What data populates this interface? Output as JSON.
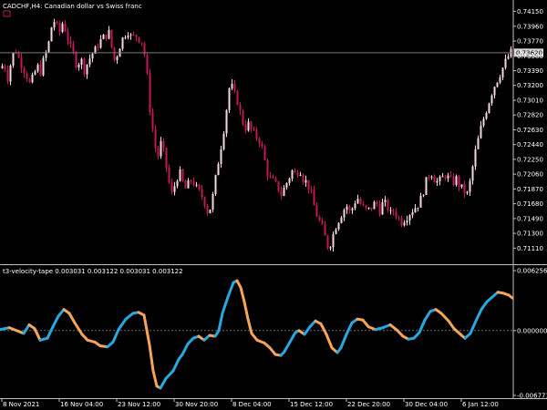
{
  "header": {
    "symbol_line": "CADCHF,H4:  Canadian dollar vs Swiss franc",
    "indicator_line": "t3-velocity-tape 0.003031 0.003122 0.003031 0.003122"
  },
  "colors": {
    "background": "#000000",
    "axis": "#c0c0c0",
    "bull_candle": "#f5d7e0",
    "bear_candle": "#c2185b",
    "price_line": "#7a7a7a",
    "osc_up": "#29a8e0",
    "osc_down": "#f5a55a",
    "zero_line": "#6a6a6a"
  },
  "chart_data": [
    {
      "type": "candlestick",
      "title": "CADCHF,H4:  Canadian dollar vs Swiss franc",
      "ylim": [
        0.7095,
        0.7425
      ],
      "y_ticks": [
        "0.74150",
        "0.73960",
        "0.73770",
        "0.73580",
        "0.73390",
        "0.73200",
        "0.73010",
        "0.72820",
        "0.72630",
        "0.72440",
        "0.72250",
        "0.72060",
        "0.71870",
        "0.71680",
        "0.71490",
        "0.71300",
        "0.71110"
      ],
      "current_price": "0.73620",
      "x_ticks": [
        "8 Nov 2021",
        "16 Nov 04:00",
        "23 Nov 12:00",
        "30 Nov 20:00",
        "8 Dec 04:00",
        "15 Dec 12:00",
        "22 Dec 20:00",
        "30 Dec 04:00",
        "6 Jan 12:00"
      ],
      "close_path": [
        [
          0,
          0.7342
        ],
        [
          4,
          0.7348
        ],
        [
          8,
          0.733
        ],
        [
          12,
          0.7352
        ],
        [
          16,
          0.7368
        ],
        [
          20,
          0.7355
        ],
        [
          24,
          0.7345
        ],
        [
          28,
          0.7335
        ],
        [
          32,
          0.7322
        ],
        [
          36,
          0.733
        ],
        [
          40,
          0.7345
        ],
        [
          44,
          0.7338
        ],
        [
          48,
          0.7355
        ],
        [
          52,
          0.7368
        ],
        [
          56,
          0.7395
        ],
        [
          60,
          0.7405
        ],
        [
          64,
          0.7385
        ],
        [
          68,
          0.74
        ],
        [
          72,
          0.739
        ],
        [
          76,
          0.737
        ],
        [
          80,
          0.736
        ],
        [
          84,
          0.7345
        ],
        [
          88,
          0.7355
        ],
        [
          92,
          0.734
        ],
        [
          96,
          0.735
        ],
        [
          100,
          0.736
        ],
        [
          104,
          0.7365
        ],
        [
          108,
          0.7375
        ],
        [
          112,
          0.738
        ],
        [
          116,
          0.7385
        ],
        [
          120,
          0.7388
        ],
        [
          124,
          0.735
        ],
        [
          128,
          0.736
        ],
        [
          132,
          0.7375
        ],
        [
          136,
          0.7385
        ],
        [
          140,
          0.739
        ],
        [
          144,
          0.738
        ],
        [
          148,
          0.7385
        ],
        [
          152,
          0.738
        ],
        [
          156,
          0.7375
        ],
        [
          160,
          0.7345
        ],
        [
          164,
          0.729
        ],
        [
          168,
          0.7255
        ],
        [
          172,
          0.7225
        ],
        [
          176,
          0.7245
        ],
        [
          180,
          0.723
        ],
        [
          184,
          0.72
        ],
        [
          188,
          0.718
        ],
        [
          192,
          0.7195
        ],
        [
          196,
          0.721
        ],
        [
          200,
          0.7195
        ],
        [
          204,
          0.7185
        ],
        [
          208,
          0.72
        ],
        [
          212,
          0.7195
        ],
        [
          216,
          0.7185
        ],
        [
          220,
          0.718
        ],
        [
          224,
          0.717
        ],
        [
          228,
          0.7155
        ],
        [
          232,
          0.717
        ],
        [
          236,
          0.72
        ],
        [
          240,
          0.723
        ],
        [
          244,
          0.7255
        ],
        [
          248,
          0.729
        ],
        [
          252,
          0.7325
        ],
        [
          256,
          0.731
        ],
        [
          260,
          0.73
        ],
        [
          264,
          0.728
        ],
        [
          268,
          0.7265
        ],
        [
          272,
          0.727
        ],
        [
          276,
          0.726
        ],
        [
          280,
          0.7255
        ],
        [
          284,
          0.725
        ],
        [
          288,
          0.7235
        ],
        [
          292,
          0.721
        ],
        [
          296,
          0.72
        ],
        [
          300,
          0.7195
        ],
        [
          304,
          0.719
        ],
        [
          308,
          0.718
        ],
        [
          312,
          0.719
        ],
        [
          316,
          0.72
        ],
        [
          320,
          0.721
        ],
        [
          324,
          0.7205
        ],
        [
          328,
          0.7215
        ],
        [
          332,
          0.72
        ],
        [
          336,
          0.7195
        ],
        [
          340,
          0.7185
        ],
        [
          344,
          0.7165
        ],
        [
          348,
          0.715
        ],
        [
          352,
          0.714
        ],
        [
          356,
          0.7125
        ],
        [
          360,
          0.711
        ],
        [
          364,
          0.7125
        ],
        [
          368,
          0.714
        ],
        [
          372,
          0.715
        ],
        [
          376,
          0.716
        ],
        [
          380,
          0.7165
        ],
        [
          384,
          0.7155
        ],
        [
          388,
          0.717
        ],
        [
          392,
          0.7175
        ],
        [
          396,
          0.7165
        ],
        [
          400,
          0.716
        ],
        [
          404,
          0.716
        ],
        [
          408,
          0.7165
        ],
        [
          412,
          0.717
        ],
        [
          416,
          0.716
        ],
        [
          420,
          0.717
        ],
        [
          424,
          0.7165
        ],
        [
          428,
          0.7155
        ],
        [
          432,
          0.716
        ],
        [
          436,
          0.715
        ],
        [
          440,
          0.7145
        ],
        [
          444,
          0.715
        ],
        [
          448,
          0.7155
        ],
        [
          452,
          0.716
        ],
        [
          456,
          0.7165
        ],
        [
          460,
          0.717
        ],
        [
          464,
          0.7185
        ],
        [
          468,
          0.72
        ],
        [
          472,
          0.721
        ],
        [
          476,
          0.72
        ],
        [
          480,
          0.7195
        ],
        [
          484,
          0.72
        ],
        [
          488,
          0.7205
        ],
        [
          492,
          0.72
        ],
        [
          496,
          0.7195
        ],
        [
          500,
          0.72
        ],
        [
          504,
          0.719
        ],
        [
          508,
          0.7185
        ],
        [
          512,
          0.718
        ],
        [
          516,
          0.72
        ],
        [
          520,
          0.723
        ],
        [
          524,
          0.725
        ],
        [
          528,
          0.727
        ],
        [
          532,
          0.7285
        ],
        [
          536,
          0.73
        ],
        [
          540,
          0.7315
        ],
        [
          544,
          0.7325
        ],
        [
          548,
          0.7335
        ],
        [
          552,
          0.7345
        ],
        [
          556,
          0.7355
        ],
        [
          560,
          0.7362
        ]
      ]
    },
    {
      "type": "line",
      "title": "t3-velocity-tape 0.003031 0.003122 0.003031 0.003122",
      "ylim": [
        -0.006771,
        0.006256
      ],
      "y_ticks": [
        "0.006256",
        "0.000000",
        "-0.006771"
      ],
      "series": [
        {
          "values": [
            [
              0,
              0.0001
            ],
            [
              10,
              0.0003
            ],
            [
              18,
              0.0
            ],
            [
              26,
              -0.0003
            ],
            [
              32,
              0.0006
            ],
            [
              38,
              0.0002
            ],
            [
              44,
              -0.001
            ],
            [
              52,
              -0.0008
            ],
            [
              58,
              0.0004
            ],
            [
              64,
              0.0015
            ],
            [
              70,
              0.0022
            ],
            [
              76,
              0.0018
            ],
            [
              82,
              0.0008
            ],
            [
              90,
              -0.0004
            ],
            [
              96,
              -0.001
            ],
            [
              104,
              -0.0012
            ],
            [
              110,
              -0.0016
            ],
            [
              118,
              -0.0017
            ],
            [
              124,
              -0.0012
            ],
            [
              130,
              0.0001
            ],
            [
              138,
              0.0012
            ],
            [
              146,
              0.0018
            ],
            [
              152,
              0.0019
            ],
            [
              158,
              0.0016
            ],
            [
              164,
              -0.0015
            ],
            [
              168,
              -0.0042
            ],
            [
              172,
              -0.0058
            ],
            [
              176,
              -0.006
            ],
            [
              182,
              -0.005
            ],
            [
              190,
              -0.0042
            ],
            [
              196,
              -0.003
            ],
            [
              200,
              -0.0025
            ],
            [
              206,
              -0.0014
            ],
            [
              212,
              -0.0008
            ],
            [
              218,
              -0.0006
            ],
            [
              224,
              -0.001
            ],
            [
              230,
              -0.0005
            ],
            [
              236,
              -0.0006
            ],
            [
              240,
              0.0
            ],
            [
              244,
              0.0018
            ],
            [
              250,
              0.0035
            ],
            [
              256,
              0.005
            ],
            [
              260,
              0.0052
            ],
            [
              264,
              0.0045
            ],
            [
              268,
              0.003
            ],
            [
              272,
              0.0012
            ],
            [
              276,
              -0.0003
            ],
            [
              282,
              -0.001
            ],
            [
              290,
              -0.0013
            ],
            [
              296,
              -0.0018
            ],
            [
              302,
              -0.0025
            ],
            [
              308,
              -0.0026
            ],
            [
              312,
              -0.0022
            ],
            [
              318,
              -0.0012
            ],
            [
              324,
              -0.0002
            ],
            [
              328,
              0.0
            ],
            [
              334,
              -0.0004
            ],
            [
              340,
              0.0004
            ],
            [
              346,
              0.001
            ],
            [
              352,
              0.0007
            ],
            [
              358,
              -0.0004
            ],
            [
              364,
              -0.0018
            ],
            [
              370,
              -0.0023
            ],
            [
              374,
              -0.0018
            ],
            [
              380,
              -0.0004
            ],
            [
              386,
              0.0008
            ],
            [
              392,
              0.0012
            ],
            [
              398,
              0.0011
            ],
            [
              404,
              0.0004
            ],
            [
              412,
              0.0001
            ],
            [
              420,
              0.0003
            ],
            [
              428,
              0.0006
            ],
            [
              436,
              0.0
            ],
            [
              442,
              -0.0006
            ],
            [
              448,
              -0.0009
            ],
            [
              454,
              -0.0008
            ],
            [
              460,
              -0.0002
            ],
            [
              466,
              0.0011
            ],
            [
              472,
              0.002
            ],
            [
              478,
              0.0022
            ],
            [
              484,
              0.0018
            ],
            [
              492,
              0.001
            ],
            [
              498,
              0.0002
            ],
            [
              504,
              -0.0003
            ],
            [
              510,
              -0.0008
            ],
            [
              516,
              -0.0003
            ],
            [
              522,
              0.001
            ],
            [
              528,
              0.0022
            ],
            [
              534,
              0.003
            ],
            [
              540,
              0.0035
            ],
            [
              546,
              0.004
            ],
            [
              552,
              0.0039
            ],
            [
              558,
              0.0037
            ],
            [
              562,
              0.0034
            ]
          ]
        }
      ]
    }
  ]
}
